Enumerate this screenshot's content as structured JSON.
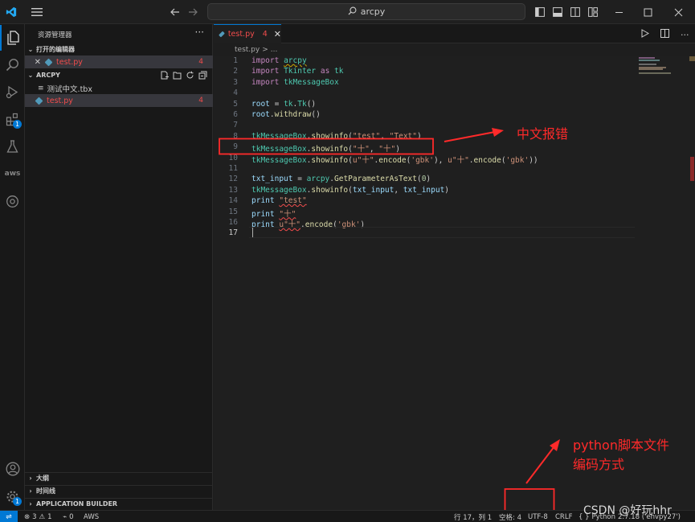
{
  "titlebar": {
    "search_text": "arcpy"
  },
  "sidebar": {
    "title": "资源管理器",
    "open_editors": {
      "header": "打开的编辑器",
      "files": [
        {
          "name": "test.py",
          "problems": "4"
        }
      ]
    },
    "folder": {
      "name": "ARCPY",
      "files": [
        {
          "name": "测试中文.tbx",
          "problems": ""
        },
        {
          "name": "test.py",
          "problems": "4"
        }
      ]
    },
    "bottom_sections": [
      "大纲",
      "时间线",
      "APPLICATION BUILDER"
    ]
  },
  "editor": {
    "tab": {
      "name": "test.py",
      "problems": "4"
    },
    "breadcrumb": {
      "file": "test.py",
      "sep": ">",
      "rest": "..."
    },
    "line_numbers": [
      "1",
      "2",
      "3",
      "4",
      "5",
      "6",
      "7",
      "8",
      "9",
      "10",
      "11",
      "12",
      "13",
      "14",
      "15",
      "16",
      "17"
    ],
    "current_line": "17"
  },
  "statusbar": {
    "errors": "3",
    "warnings": "1",
    "ports": "0",
    "aws": "AWS",
    "position": "行 17，列 1",
    "spaces": "空格: 4",
    "encoding": "UTF-8",
    "eol": "CRLF",
    "language": "Python",
    "interpreter": "2.7.18 ('envpy27')"
  },
  "annotations": {
    "chinese_error": "中文报错",
    "encoding_note_line1": "python脚本文件",
    "encoding_note_line2": "编码方式",
    "color": "#ff2a2a"
  },
  "watermark": "CSDN @好玩hhr",
  "colors": {
    "accent": "#0078d4",
    "error": "#f14c4c",
    "keyword": "#c586c0",
    "string": "#ce9178"
  }
}
